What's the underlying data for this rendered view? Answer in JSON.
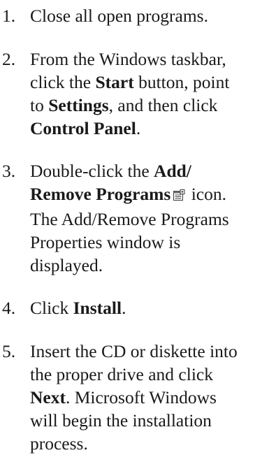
{
  "steps": [
    {
      "number": "1.",
      "lines": [
        [
          "Close all open programs."
        ]
      ]
    },
    {
      "number": "2.",
      "lines": [
        [
          "From the Windows taskbar,"
        ],
        [
          "click the ",
          "Start",
          " button, point"
        ],
        [
          "to ",
          "Settings",
          ", and then click"
        ],
        [
          "Control Panel",
          "."
        ]
      ]
    },
    {
      "number": "3.",
      "lines": [
        [
          "Double-click the ",
          "Add/"
        ],
        [
          "Remove Programs",
          "icon."
        ],
        [
          "The Add/Remove Programs"
        ],
        [
          "Properties window is"
        ],
        [
          "displayed."
        ]
      ],
      "icon": "control-panel-applet-icon"
    },
    {
      "number": "4.",
      "lines": [
        [
          "Click ",
          "Install",
          "."
        ]
      ]
    },
    {
      "number": "5.",
      "lines": [
        [
          "Insert the CD or diskette into"
        ],
        [
          "the proper drive and click"
        ],
        [
          "Next",
          ". Microsoft Windows"
        ],
        [
          "will begin the installation"
        ],
        [
          "process."
        ]
      ]
    }
  ]
}
